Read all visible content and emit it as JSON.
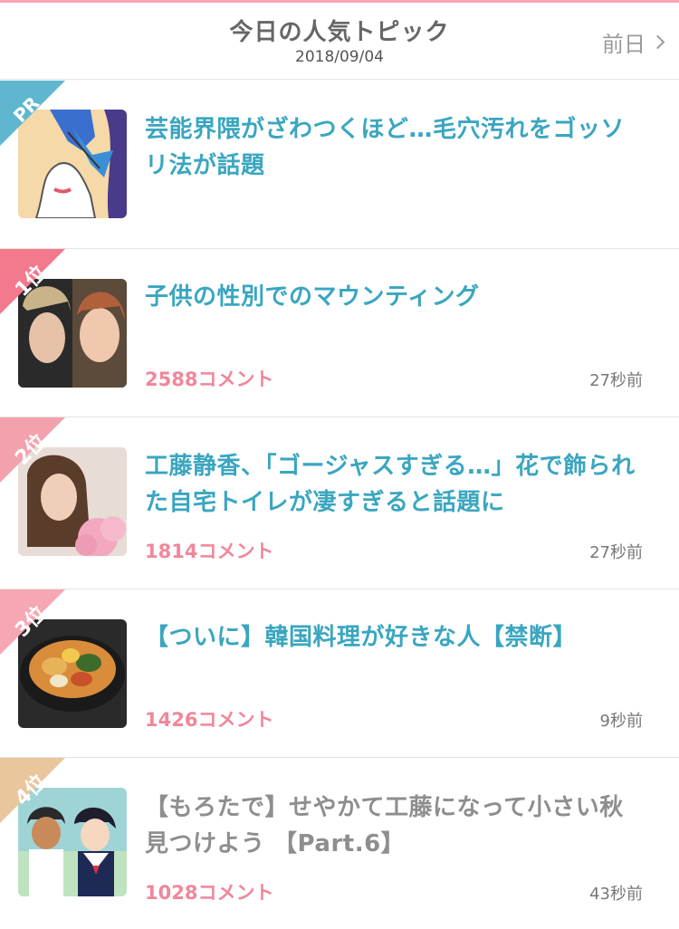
{
  "header": {
    "title": "今日の人気トピック",
    "date": "2018/09/04",
    "prev_label": "前日"
  },
  "colors": {
    "pr_ribbon": "#5fb6cf",
    "rank1": "#f3798c",
    "rank2": "#f4a1ae",
    "rank3": "#f7a7b4",
    "rank4": "#e9c69b",
    "title_blue": "#3aa6c0",
    "comment_pink": "#f0879a"
  },
  "topics": [
    {
      "badge": "PR",
      "title": "芸能界隈がざわつくほど…毛穴汚れをゴッソリ法が話題",
      "comments": "",
      "time": ""
    },
    {
      "badge": "1位",
      "title": "子供の性別でのマウンティング",
      "comments": "2588コメント",
      "time": "27秒前"
    },
    {
      "badge": "2位",
      "title": "工藤静香、「ゴージャスすぎる…」花で飾られた自宅トイレが凄すぎると話題に",
      "comments": "1814コメント",
      "time": "27秒前"
    },
    {
      "badge": "3位",
      "title": "【ついに】韓国料理が好きな人【禁断】",
      "comments": "1426コメント",
      "time": "9秒前"
    },
    {
      "badge": "4位",
      "title": "【もろたで】せやかて工藤になって小さい秋見つけよう 【Part.6】",
      "comments": "1028コメント",
      "time": "43秒前"
    }
  ]
}
